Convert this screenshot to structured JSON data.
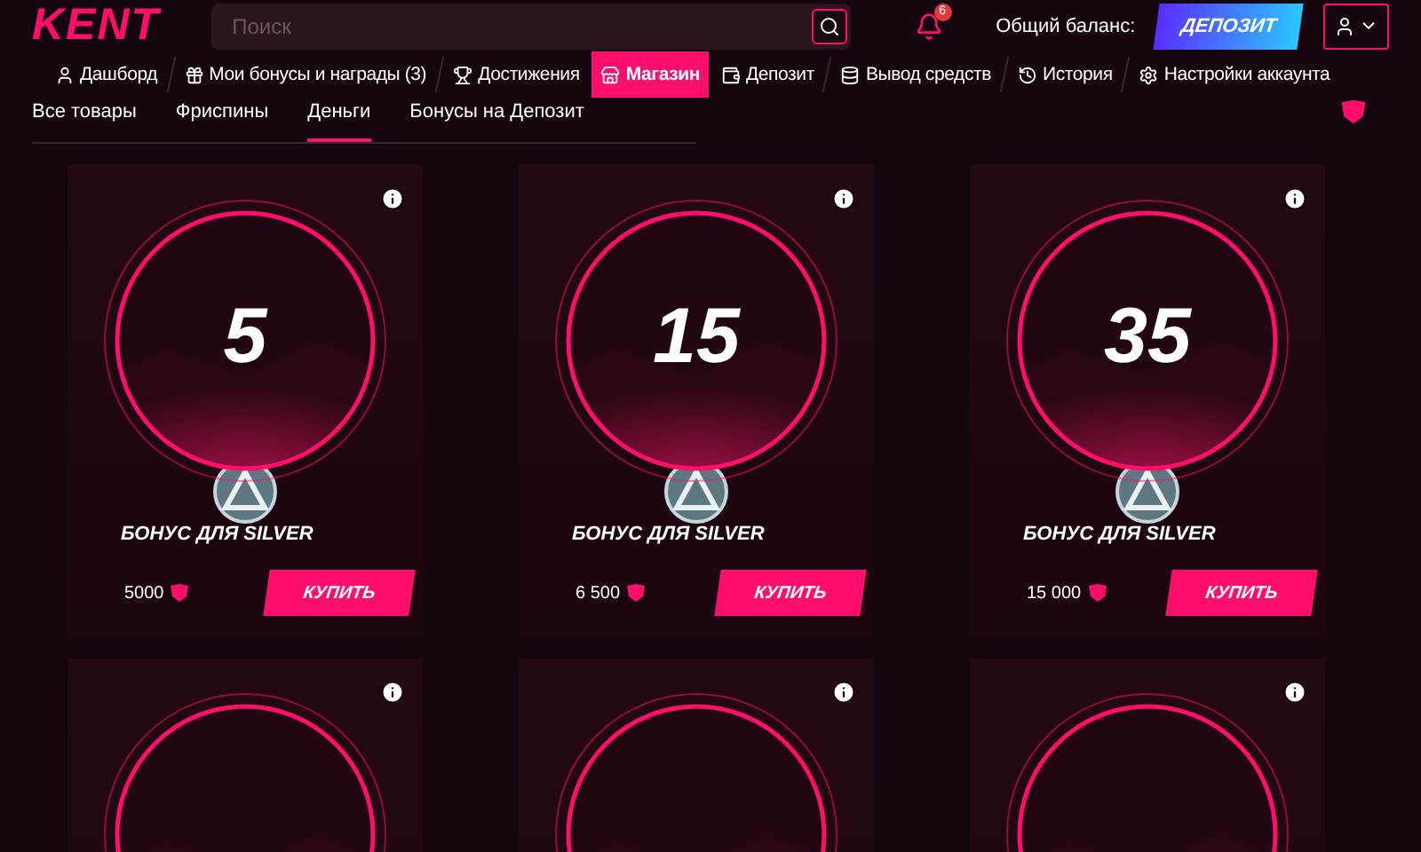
{
  "header": {
    "logo": "KENT",
    "search": {
      "placeholder": "Поиск"
    },
    "notifications": {
      "count": "6"
    },
    "balance_label": "Общий баланс:",
    "deposit_button": "ДЕПОЗИТ"
  },
  "nav": [
    {
      "label": "Дашборд",
      "selected": false
    },
    {
      "label": "Мои бонусы и награды (3)",
      "selected": false
    },
    {
      "label": "Достижения",
      "selected": false
    },
    {
      "label": "Магазин",
      "selected": true
    },
    {
      "label": "Депозит",
      "selected": false
    },
    {
      "label": "Вывод средств",
      "selected": false
    },
    {
      "label": "История",
      "selected": false
    },
    {
      "label": "Настройки аккаунта",
      "selected": false
    }
  ],
  "tabs": [
    {
      "label": "Все товары",
      "selected": false
    },
    {
      "label": "Фриспины",
      "selected": false
    },
    {
      "label": "Деньги",
      "selected": true
    },
    {
      "label": "Бонусы на Депозит",
      "selected": false
    }
  ],
  "products": [
    {
      "kind": "full",
      "amount": "5",
      "title": "БОНУС ДЛЯ SILVER",
      "price": "5000",
      "button": "КУПИТЬ"
    },
    {
      "kind": "full",
      "amount": "15",
      "title": "БОНУС ДЛЯ SILVER",
      "price": "6 500",
      "button": "КУПИТЬ"
    },
    {
      "kind": "full",
      "amount": "35",
      "title": "БОНУС ДЛЯ SILVER",
      "price": "15 000",
      "button": "КУПИТЬ"
    },
    {
      "kind": "partial"
    },
    {
      "kind": "partial"
    },
    {
      "kind": "partial"
    }
  ]
}
